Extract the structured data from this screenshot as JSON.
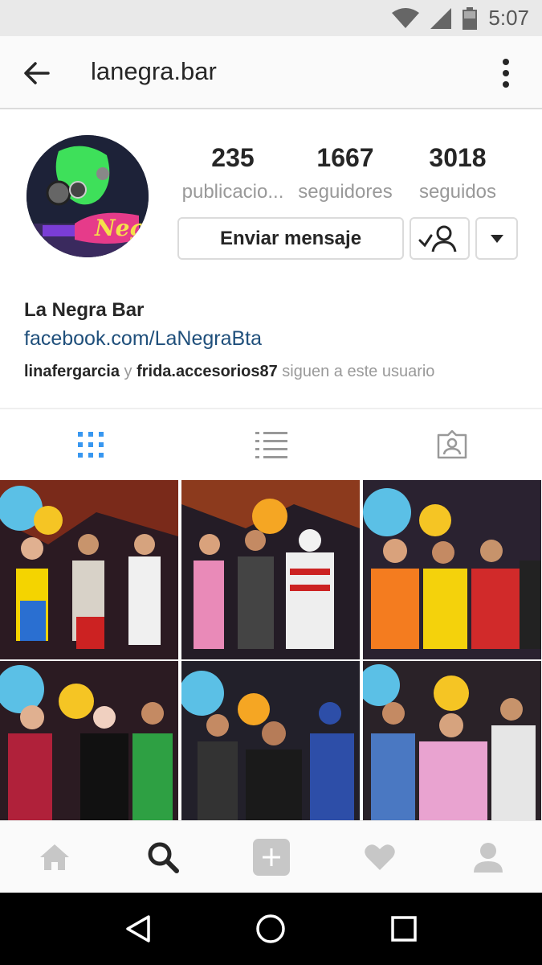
{
  "status_bar": {
    "time": "5:07",
    "icons": [
      "wifi-icon",
      "signal-icon",
      "battery-icon"
    ]
  },
  "top_bar": {
    "back_icon": "arrow-left-icon",
    "title": "lanegra.bar",
    "menu_icon": "more-vertical-icon"
  },
  "profile": {
    "avatar_icon": "profile-avatar",
    "stats": [
      {
        "value": "235",
        "label": "publicacio..."
      },
      {
        "value": "1667",
        "label": "seguidores"
      },
      {
        "value": "3018",
        "label": "seguidos"
      }
    ],
    "message_button": "Enviar mensaje",
    "following_icon": "user-check-icon",
    "dropdown_icon": "caret-down-icon",
    "name": "La Negra Bar",
    "link": "facebook.com/LaNegraBta",
    "followed_by": {
      "user1": "linafergarcia",
      "conj": "y",
      "user2": "frida.accesorios87",
      "suffix": "siguen a este usuario"
    }
  },
  "tabs": [
    {
      "icon": "grid-icon",
      "active": true
    },
    {
      "icon": "list-icon",
      "active": false
    },
    {
      "icon": "tagged-icon",
      "active": false
    }
  ],
  "grid": {
    "count": 6
  },
  "bottom_nav": [
    "home-icon",
    "search-icon",
    "add-icon",
    "heart-icon",
    "profile-icon"
  ],
  "android_nav": [
    "back-triangle-icon",
    "home-circle-icon",
    "recents-square-icon"
  ],
  "colors": {
    "link": "#1f4f7b",
    "active_tab": "#3897f0",
    "muted": "#999999",
    "border": "#dbdbdb"
  }
}
